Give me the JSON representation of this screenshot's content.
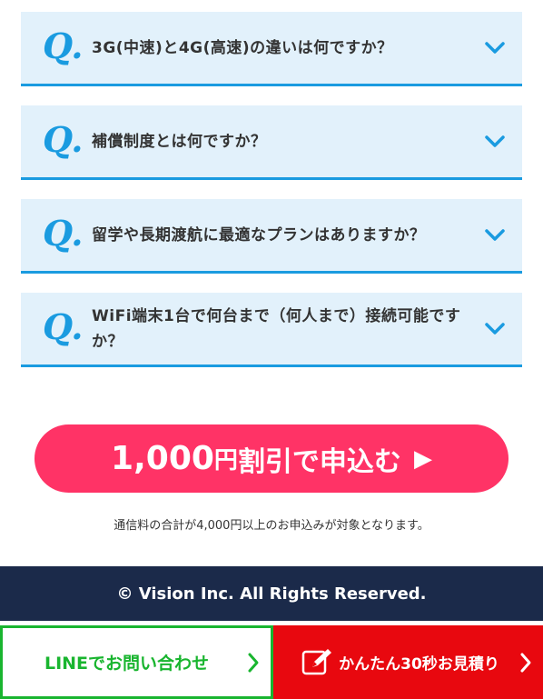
{
  "faq": {
    "q_mark": "Q.",
    "items": [
      {
        "question": "3G(中速)と4G(高速)の違いは何ですか？"
      },
      {
        "question": "補償制度とは何ですか？"
      },
      {
        "question": "留学や長期渡航に最適なプランはありますか？"
      },
      {
        "question": "WiFi端末1台で何台まで（何人まで）接続可能ですか？"
      }
    ]
  },
  "cta": {
    "amount": "1,000",
    "yen": "円",
    "rest": "割引で申込む",
    "arrow": "▶",
    "note": "通信料の合計が4,000円以上のお申込みが対象となります。"
  },
  "footer": {
    "copyright": "© Vision Inc. All Rights Reserved."
  },
  "bottom_bar": {
    "line_label": "LINEでお問い合わせ",
    "estimate_label": "かんたん30秒お見積り"
  },
  "colors": {
    "accent_blue": "#1a9be0",
    "faq_bg": "#e2f1fb",
    "cta_pink": "#ff3366",
    "footer_navy": "#1b2a4a",
    "line_green": "#19b52f",
    "estimate_red": "#e8080f"
  },
  "icons": {
    "faq_toggle": "chevron-down-icon",
    "bottom_chevron": "chevron-right-icon",
    "estimate": "pencil-icon"
  }
}
